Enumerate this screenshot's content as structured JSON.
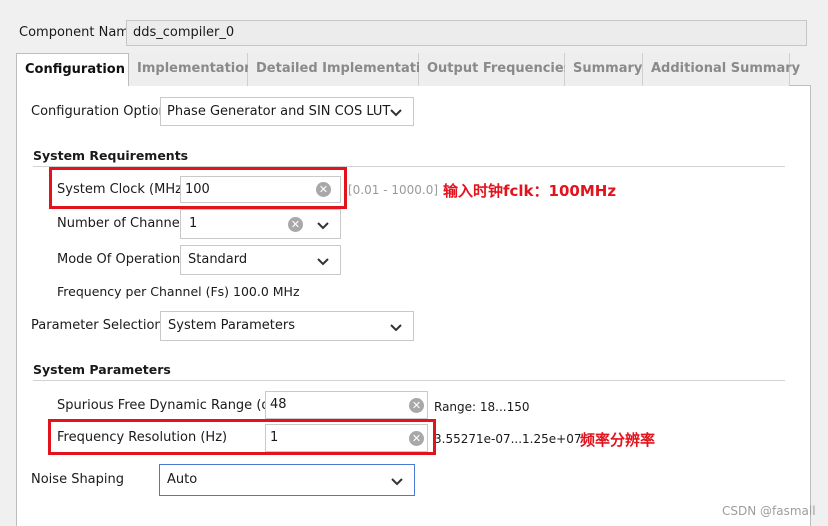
{
  "component_name": {
    "label": "Component Name",
    "value": "dds_compiler_0"
  },
  "tabs": [
    {
      "label": "Configuration",
      "active": true
    },
    {
      "label": "Implementation",
      "active": false
    },
    {
      "label": "Detailed Implementation",
      "active": false
    },
    {
      "label": "Output Frequencies",
      "active": false
    },
    {
      "label": "Summary",
      "active": false
    },
    {
      "label": "Additional Summary",
      "active": false
    }
  ],
  "config_options": {
    "label": "Configuration Options",
    "value": "Phase Generator and SIN COS LUT"
  },
  "system_requirements": {
    "heading": "System Requirements",
    "system_clock": {
      "label": "System Clock (MHz)",
      "value": "100",
      "range": "[0.01 - 1000.0]"
    },
    "num_channels": {
      "label": "Number of Channels",
      "value": "1"
    },
    "mode_of_operation": {
      "label": "Mode Of Operation",
      "value": "Standard"
    },
    "freq_per_channel": "Frequency per Channel (Fs) 100.0 MHz"
  },
  "parameter_selection": {
    "label": "Parameter Selection",
    "value": "System Parameters"
  },
  "system_parameters": {
    "heading": "System Parameters",
    "sfdr": {
      "label": "Spurious Free Dynamic Range (dB)",
      "value": "48",
      "range": "Range: 18...150"
    },
    "freq_resolution": {
      "label": "Frequency Resolution (Hz)",
      "value": "1",
      "range": "3.55271e-07...1.25e+07"
    }
  },
  "noise_shaping": {
    "label": "Noise Shaping",
    "value": "Auto"
  },
  "annotations": {
    "clock": "输入时钟fclk：100MHz",
    "resolution": "频率分辨率"
  },
  "watermark": "CSDN @fasmall",
  "colors": {
    "annotation": "#e3131e",
    "focus_border": "#4a7ad6"
  }
}
